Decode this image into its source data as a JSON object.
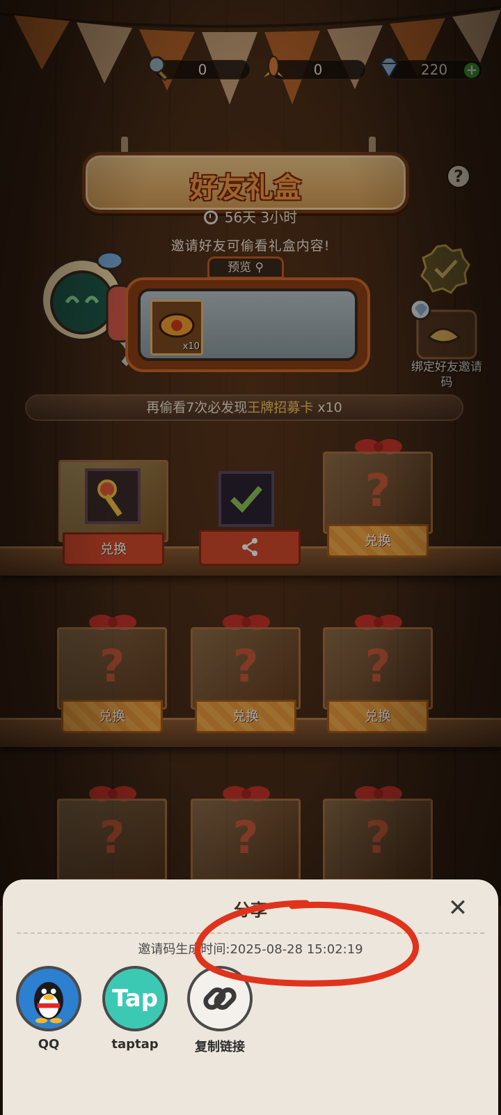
{
  "currencies": [
    {
      "icon": "magnifier-icon",
      "value": "0"
    },
    {
      "icon": "rocket-icon",
      "value": "0"
    },
    {
      "icon": "diamond-icon",
      "value": "220"
    }
  ],
  "header": {
    "title": "好友礼盒",
    "help": "?",
    "timer": "56天  3小时",
    "invite_text": "邀请好友可偷看礼盒内容!",
    "preview_label": "预览"
  },
  "reward": {
    "count": "x10"
  },
  "bind": {
    "label": "绑定好友邀请码"
  },
  "hint": {
    "prefix": "再偷看7次必发现",
    "highlight": "王牌招募卡",
    "suffix": " x10"
  },
  "boxes": [
    {
      "label": "兑换",
      "type": "item-key"
    },
    {
      "label": "",
      "type": "share"
    },
    {
      "label": "兑换",
      "type": "mystery"
    },
    {
      "label": "兑换",
      "type": "mystery"
    },
    {
      "label": "兑换",
      "type": "mystery"
    },
    {
      "label": "兑换",
      "type": "mystery"
    },
    {
      "label": "",
      "type": "mystery"
    },
    {
      "label": "",
      "type": "mystery"
    },
    {
      "label": "",
      "type": "mystery"
    }
  ],
  "share_sheet": {
    "title": "分享",
    "close": "✕",
    "code_time": "邀请码生成时间:2025-08-28  15:02:19",
    "options": [
      {
        "label": "QQ",
        "icon": "qq-icon"
      },
      {
        "label": "taptap",
        "icon": "taptap-icon",
        "logo_text": "Tap"
      },
      {
        "label": "复制链接",
        "icon": "link-icon"
      }
    ]
  },
  "colors": {
    "accent_orange": "#f39a47",
    "mark_red": "#e0331c",
    "sheet_bg": "#ede6dc"
  }
}
